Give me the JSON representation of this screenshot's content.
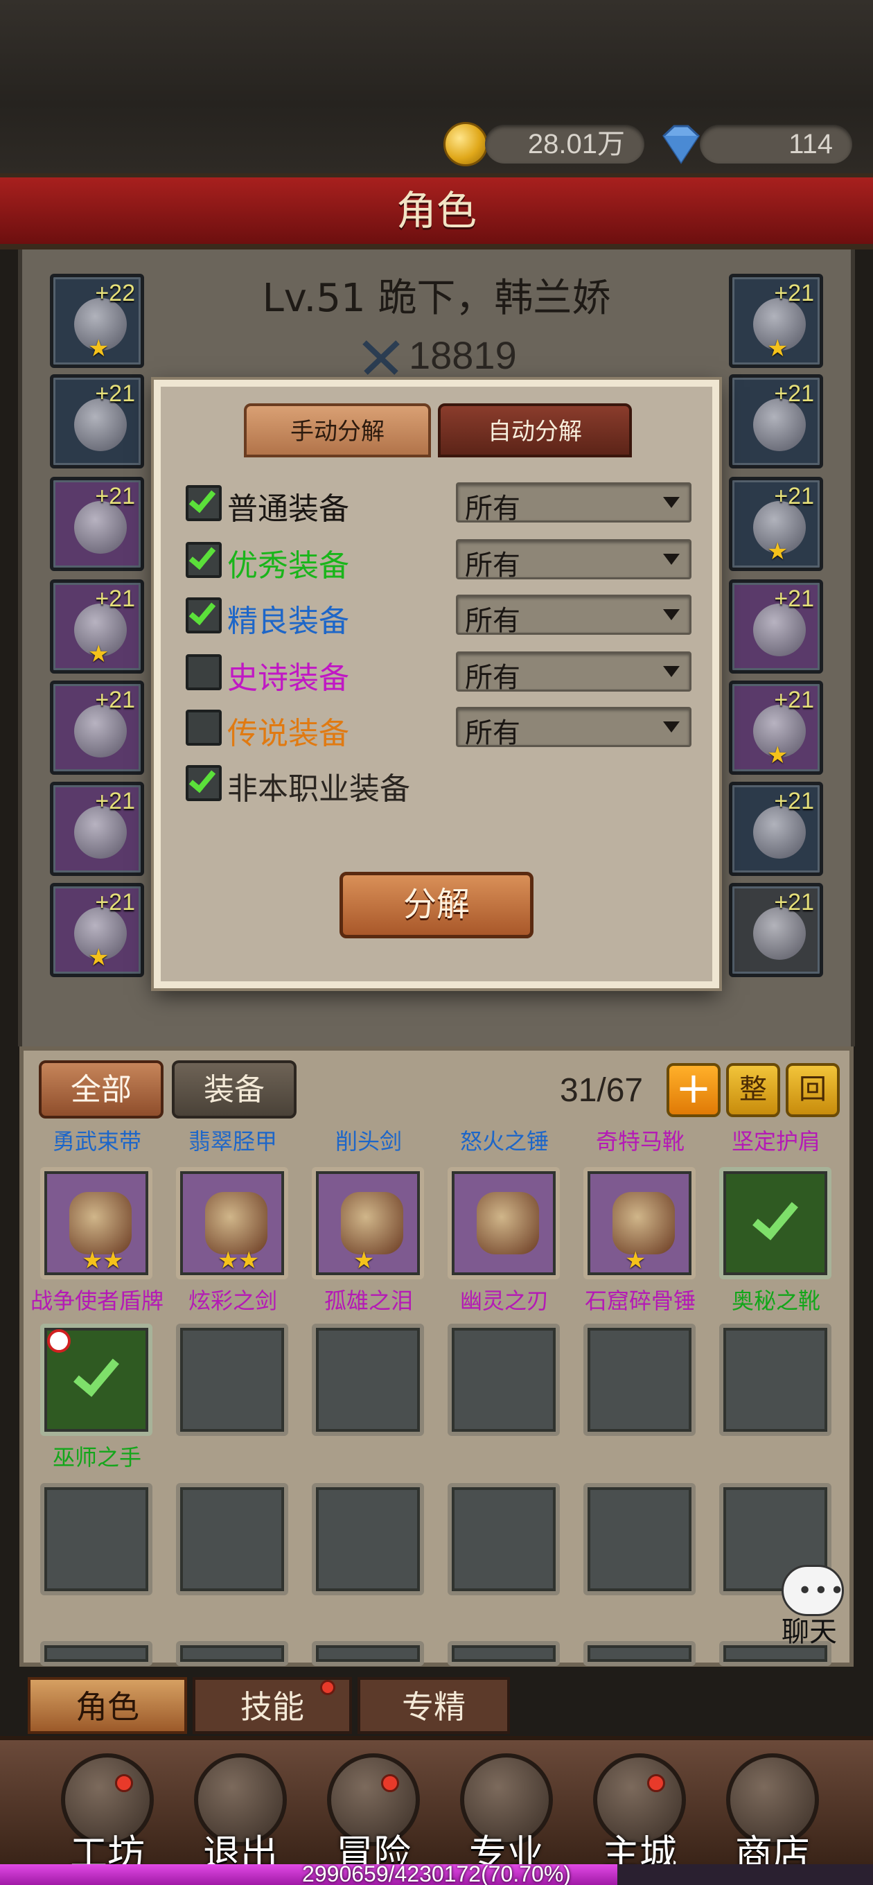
{
  "currency": {
    "gold": "28.01万",
    "diamond": "114"
  },
  "panel_title": "角色",
  "character": {
    "name": "Lv.51 跪下，韩兰娇",
    "power": "18819"
  },
  "left_equipment": [
    {
      "level": "+22",
      "stars": 1
    },
    {
      "level": "+21",
      "stars": 0
    },
    {
      "level": "+21",
      "stars": 0
    },
    {
      "level": "+21",
      "stars": 1
    },
    {
      "level": "+21",
      "stars": 0
    },
    {
      "level": "+21",
      "stars": 0
    },
    {
      "level": "+21",
      "stars": 1
    }
  ],
  "right_equipment": [
    {
      "level": "+21",
      "stars": 1
    },
    {
      "level": "+21",
      "stars": 0
    },
    {
      "level": "+21",
      "stars": 1
    },
    {
      "level": "+21",
      "stars": 0
    },
    {
      "level": "+21",
      "stars": 1
    },
    {
      "level": "+21",
      "stars": 0
    },
    {
      "level": "+21",
      "stars": 0
    }
  ],
  "decompose_dialog": {
    "tabs": [
      "手动分解",
      "自动分解"
    ],
    "active_tab": 0,
    "options": [
      {
        "label": "普通装备",
        "checked": true,
        "color": "#1a1613",
        "filter": "所有"
      },
      {
        "label": "优秀装备",
        "checked": true,
        "color": "#19b51a",
        "filter": "所有"
      },
      {
        "label": "精良装备",
        "checked": true,
        "color": "#1d66c8",
        "filter": "所有"
      },
      {
        "label": "史诗装备",
        "checked": false,
        "color": "#c018c4",
        "filter": "所有"
      },
      {
        "label": "传说装备",
        "checked": false,
        "color": "#e07a12",
        "filter": "所有"
      }
    ],
    "non_class_option": {
      "label": "非本职业装备",
      "checked": true
    },
    "decompose_button": "分解"
  },
  "inventory": {
    "filter_all": "全部",
    "filter_equip": "装备",
    "count": "31/67",
    "plus_button": "+",
    "sort_button": "整",
    "recycle_button": "回",
    "top_row_names": [
      {
        "text": "勇武束带",
        "color": "#1d66c8"
      },
      {
        "text": "翡翠胫甲",
        "color": "#1d66c8"
      },
      {
        "text": "削头剑",
        "color": "#1d66c8"
      },
      {
        "text": "怒火之锤",
        "color": "#1d66c8"
      },
      {
        "text": "奇特马靴",
        "color": "#b41ab5"
      },
      {
        "text": "坚定护肩",
        "color": "#b41ab5"
      }
    ],
    "items": [
      {
        "name": "战争使者盾牌",
        "stars": 2,
        "rarity": "purple",
        "name_color": "#b41ab5"
      },
      {
        "name": "炫彩之剑",
        "stars": 2,
        "rarity": "purple",
        "name_color": "#b41ab5"
      },
      {
        "name": "孤雄之泪",
        "stars": 1,
        "rarity": "purple",
        "name_color": "#b41ab5"
      },
      {
        "name": "幽灵之刃",
        "stars": 0,
        "rarity": "purple",
        "name_color": "#b41ab5"
      },
      {
        "name": "石窟碎骨锤",
        "stars": 1,
        "rarity": "purple",
        "name_color": "#b41ab5"
      },
      {
        "name": "奥秘之靴",
        "stars": 0,
        "rarity": "green",
        "name_color": "#13a61a"
      },
      {
        "name": "巫师之手",
        "stars": 0,
        "rarity": "green",
        "name_color": "#13a61a"
      }
    ],
    "chat_label": "聊天"
  },
  "bottom_tabs": [
    "角色",
    "技能",
    "专精"
  ],
  "nav": [
    {
      "label": "工坊",
      "badge": true
    },
    {
      "label": "退出",
      "badge": false
    },
    {
      "label": "冒险",
      "badge": true
    },
    {
      "label": "专业",
      "badge": false
    },
    {
      "label": "主城",
      "badge": true
    },
    {
      "label": "商店",
      "badge": false
    }
  ],
  "exp": {
    "text": "2990659/4230172(70.70%)",
    "progress": 0.707
  }
}
